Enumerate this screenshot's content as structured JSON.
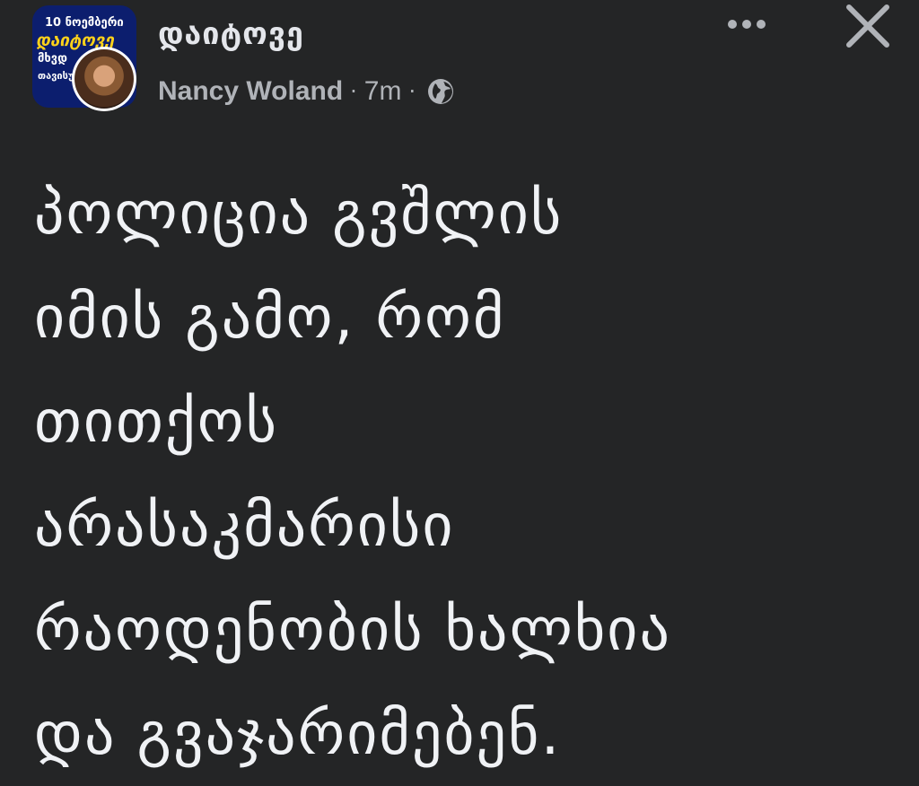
{
  "header": {
    "group_avatar_text": [
      "10 ნოემბერი",
      "დაიტოვე",
      "მხვდ",
      "თავისუ"
    ],
    "group_name": "დაიტოვე",
    "author": "Nancy Woland",
    "separator": "·",
    "time": "7m",
    "privacy_icon": "globe-icon",
    "more_icon": "more-horizontal-icon",
    "close_icon": "close-icon"
  },
  "post": {
    "lines": [
      "პოლიცია გვშლის",
      "იმის გამო, რომ",
      "თითქოს",
      "არასაკმარისი",
      "რაოდენობის ხალხია",
      "და გვაჯარიმებენ."
    ]
  },
  "colors": {
    "background": "#242526",
    "primary_text": "#e4e6eb",
    "secondary_text": "#b0b3b8",
    "group_avatar_bg": "#0c1e6e",
    "group_avatar_accent": "#ffd21a"
  }
}
